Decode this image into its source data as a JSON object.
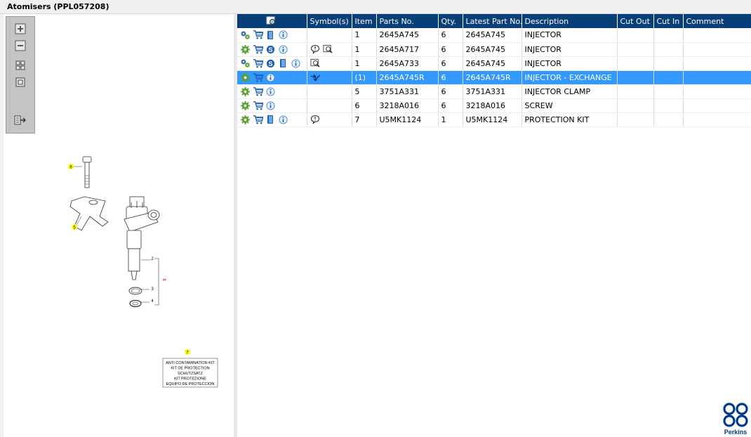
{
  "window": {
    "title": "Atomisers (PPL057208)"
  },
  "colors": {
    "header_bg": "#083f78",
    "selected_row": "#3399ff",
    "brand": "#003a8c"
  },
  "toolbox": {
    "tools": [
      "zoom-in-icon",
      "zoom-out-icon",
      "fit-page-icon",
      "actual-size-icon",
      "export-icon"
    ]
  },
  "table": {
    "columns": [
      "",
      "Symbol(s)",
      "Item",
      "Parts No.",
      "Qty.",
      "Latest Part No.",
      "Description",
      "Cut Out",
      "Cut In",
      "Comment"
    ],
    "selected_index": 3,
    "rows": [
      {
        "icons": [
          "gears-icon",
          "cart-icon",
          "book-icon",
          "info-icon"
        ],
        "symbols": [],
        "item": "1",
        "part_no": "2645A745",
        "qty": "6",
        "latest_part_no": "2645A745",
        "description": "INJECTOR",
        "cut_out": "",
        "cut_in": "",
        "comment": ""
      },
      {
        "icons": [
          "gear-icon",
          "cart-icon",
          "s-icon",
          "info-icon"
        ],
        "symbols": [
          "speech-bubble-icon",
          "picture-magnifier-icon"
        ],
        "item": "1",
        "part_no": "2645A717",
        "qty": "6",
        "latest_part_no": "2645A745",
        "description": "INJECTOR",
        "cut_out": "",
        "cut_in": "",
        "comment": ""
      },
      {
        "icons": [
          "gears-icon",
          "cart-icon",
          "s-icon",
          "book-icon",
          "info-icon"
        ],
        "symbols": [
          "picture-magnifier-icon"
        ],
        "item": "1",
        "part_no": "2645A733",
        "qty": "6",
        "latest_part_no": "2645A745",
        "description": "INJECTOR",
        "cut_out": "",
        "cut_in": "",
        "comment": ""
      },
      {
        "icons": [
          "gear-icon",
          "cart-icon",
          "info-icon"
        ],
        "symbols": [
          "exchange-arrow-icon"
        ],
        "item": "(1)",
        "part_no": "2645A745R",
        "qty": "6",
        "latest_part_no": "2645A745R",
        "description": "INJECTOR - EXCHANGE",
        "cut_out": "",
        "cut_in": "",
        "comment": ""
      },
      {
        "icons": [
          "gear-icon",
          "cart-icon",
          "info-icon"
        ],
        "symbols": [],
        "item": "5",
        "part_no": "3751A331",
        "qty": "6",
        "latest_part_no": "3751A331",
        "description": "INJECTOR CLAMP",
        "cut_out": "",
        "cut_in": "",
        "comment": ""
      },
      {
        "icons": [
          "gear-icon",
          "cart-icon",
          "info-icon"
        ],
        "symbols": [],
        "item": "6",
        "part_no": "3218A016",
        "qty": "6",
        "latest_part_no": "3218A016",
        "description": "SCREW",
        "cut_out": "",
        "cut_in": "",
        "comment": ""
      },
      {
        "icons": [
          "gear-icon",
          "cart-icon",
          "book-icon",
          "info-icon"
        ],
        "symbols": [
          "speech-bubble-icon"
        ],
        "item": "7",
        "part_no": "U5MK1124",
        "qty": "1",
        "latest_part_no": "U5MK1124",
        "description": "PROTECTION KIT",
        "cut_out": "",
        "cut_in": "",
        "comment": ""
      }
    ]
  },
  "diagram": {
    "callouts": [
      "6",
      "5",
      "2",
      "3",
      "4",
      "8",
      "7"
    ],
    "kit_label_lines": [
      "ANTI CONTAMINATION KIT",
      "KIT DE PROTECTION",
      "SCHUTZSATZ",
      "KIT PROTEZIONE",
      "EQUIPO DE PROTECCION"
    ]
  },
  "brand": {
    "name": "Perkins"
  }
}
